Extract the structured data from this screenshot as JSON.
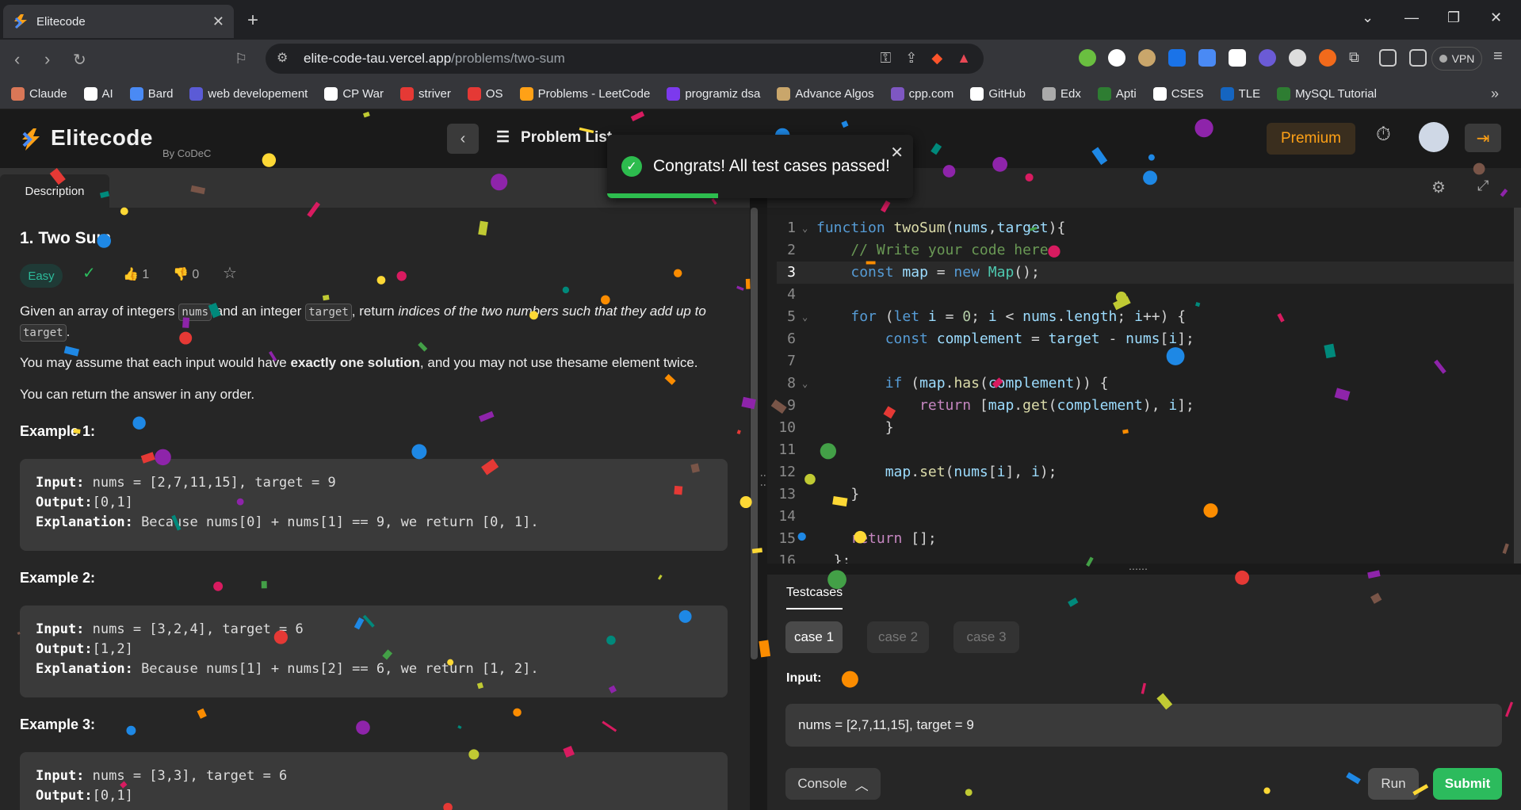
{
  "browser": {
    "tab_title": "Elitecode",
    "url_domain": "elite-code-tau.vercel.app",
    "url_path": "/problems/two-sum",
    "vpn_label": "VPN",
    "bookmarks": [
      "Claude",
      "AI",
      "Bard",
      "web developement",
      "CP War",
      "striver",
      "OS",
      "Problems - LeetCode",
      "programiz dsa",
      "Advance Algos",
      "cpp.com",
      "GitHub",
      "Edx",
      "Apti",
      "CSES",
      "TLE",
      "MySQL Tutorial"
    ],
    "bookmark_colors": [
      "#d97757",
      "#ffffff",
      "#4a8af4",
      "#5b5bd6",
      "#ffffff",
      "#e53935",
      "#e53935",
      "#ffa116",
      "#7c3aed",
      "#c9a66b",
      "#7e57c2",
      "#ffffff",
      "#aaaaaa",
      "#2e7d32",
      "#ffffff",
      "#1565c0",
      "#2e7d32"
    ]
  },
  "header": {
    "logo": "Elitecode",
    "logo_sub": "By CoDeC",
    "problem_list": "Problem List",
    "premium": "Premium"
  },
  "toast": {
    "message": "Congrats! All test cases passed!"
  },
  "problem": {
    "tab": "Description",
    "title": "1. Two Sum",
    "difficulty": "Easy",
    "likes": "1",
    "dislikes": "0",
    "p1_a": "Given an array of integers ",
    "p1_code1": "nums",
    "p1_b": " and an integer ",
    "p1_code2": "target",
    "p1_c": ", return ",
    "p1_em": "indices of the two numbers such that they add up to",
    "p1_code3": "target",
    "p1_d": ".",
    "p2_a": "You may assume that each input would have ",
    "p2_b": "exactly one solution",
    "p2_c": ", and you may not use thesame element twice.",
    "p3": "You can return the answer in any order.",
    "examples": [
      {
        "heading": "Example 1:",
        "input": " nums = [2,7,11,15], target = 9",
        "output": "[0,1]",
        "explanation": " Because nums[0] + nums[1] == 9, we return [0, 1]."
      },
      {
        "heading": "Example 2:",
        "input": " nums = [3,2,4], target = 6",
        "output": "[1,2]",
        "explanation": " Because nums[1] + nums[2] == 6, we return [1, 2]."
      },
      {
        "heading": "Example 3:",
        "input": "  nums = [3,3], target = 6",
        "output": "[0,1]",
        "explanation": ""
      }
    ],
    "labels": {
      "input": "Input:",
      "output": "Output:",
      "explanation": "Explanation:"
    }
  },
  "editor": {
    "lines": [
      "function twoSum(nums,target){",
      "    // Write your code here",
      "    const map = new Map();",
      "",
      "    for (let i = 0; i < nums.length; i++) {",
      "        const complement = target - nums[i];",
      "",
      "        if (map.has(complement)) {",
      "            return [map.get(complement), i];",
      "        }",
      "",
      "        map.set(nums[i], i);",
      "    }",
      "",
      "    return [];",
      "  };"
    ],
    "active_line": 3
  },
  "tests": {
    "tab": "Testcases",
    "cases": [
      "case 1",
      "case 2",
      "case 3"
    ],
    "input_label": "Input:",
    "input_value": "nums = [2,7,11,15], target = 9",
    "console": "Console",
    "run": "Run",
    "submit": "Submit"
  }
}
